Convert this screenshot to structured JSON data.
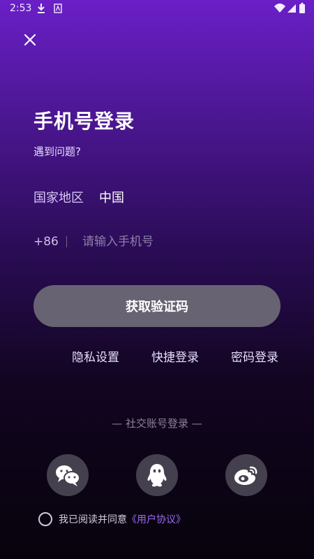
{
  "status_bar": {
    "time": "2:53",
    "icons": [
      "download-icon",
      "sim-a-icon",
      "wifi-icon",
      "signal-icon",
      "battery-icon"
    ]
  },
  "close_icon": "close-icon",
  "title": "手机号登录",
  "help_link": "遇到问题?",
  "region": {
    "label": "国家地区",
    "value": "中国"
  },
  "phone": {
    "country_code": "+86",
    "placeholder": "请输入手机号"
  },
  "get_code_button": "获取验证码",
  "links": {
    "privacy": "隐私设置",
    "quick_login": "快捷登录",
    "password_login": "密码登录"
  },
  "social": {
    "title": "— 社交账号登录 —",
    "icons": [
      "wechat-icon",
      "qq-icon",
      "weibo-icon"
    ]
  },
  "agreement": {
    "text": "我已阅读并同意",
    "link": "《用户协议》"
  },
  "colors": {
    "accent": "#9b6cf2",
    "button": "#676372",
    "gradient_top": "#6a1fc7",
    "gradient_bottom": "#07030c"
  }
}
